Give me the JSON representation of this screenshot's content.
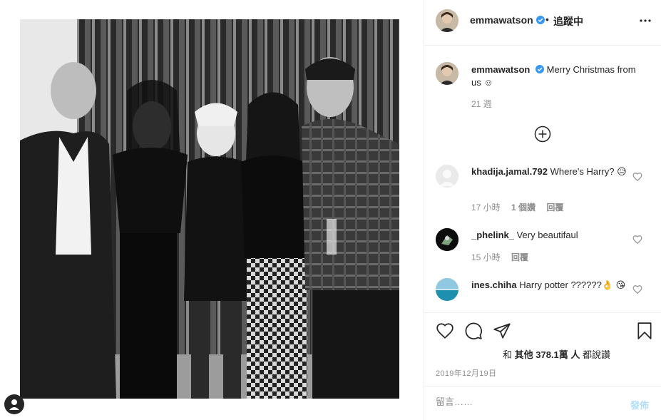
{
  "post": {
    "image_alt": "Black and white group photo of five people",
    "author": {
      "username": "emmawatson",
      "verified": true,
      "follow_status": "追蹤中"
    },
    "caption": {
      "username": "emmawatson",
      "text": "Merry Christmas from us ☺",
      "time": "21 週"
    },
    "comments": [
      {
        "username": "khadija.jamal.792",
        "text": "Where's Harry? 😥",
        "time": "17 小時",
        "likes": "1 個讚",
        "reply": "回覆",
        "avatar_icon": "default-avatar-icon"
      },
      {
        "username": "_phelink_",
        "text": "Very beautifaul",
        "time": "15 小時",
        "reply": "回覆",
        "avatar_icon": "user-avatar-icon"
      },
      {
        "username": "ines.chiha",
        "text": "Harry potter ??????👌 😘",
        "avatar_icon": "user-avatar-icon"
      }
    ],
    "actions": {
      "like_icon": "heart-icon",
      "comment_icon": "comment-icon",
      "share_icon": "share-icon",
      "save_icon": "bookmark-icon"
    },
    "likes": {
      "prefix": "和",
      "others_label": "其他 378.1萬 人",
      "suffix": "都說讚"
    },
    "date": "2019年12月19日",
    "add_comment": {
      "placeholder": "留言……",
      "post_label": "發佈"
    }
  },
  "colors": {
    "verified_blue": "#3897f0",
    "post_button_disabled": "#b2dffc",
    "meta_gray": "#8e8e8e",
    "text": "#262626"
  }
}
